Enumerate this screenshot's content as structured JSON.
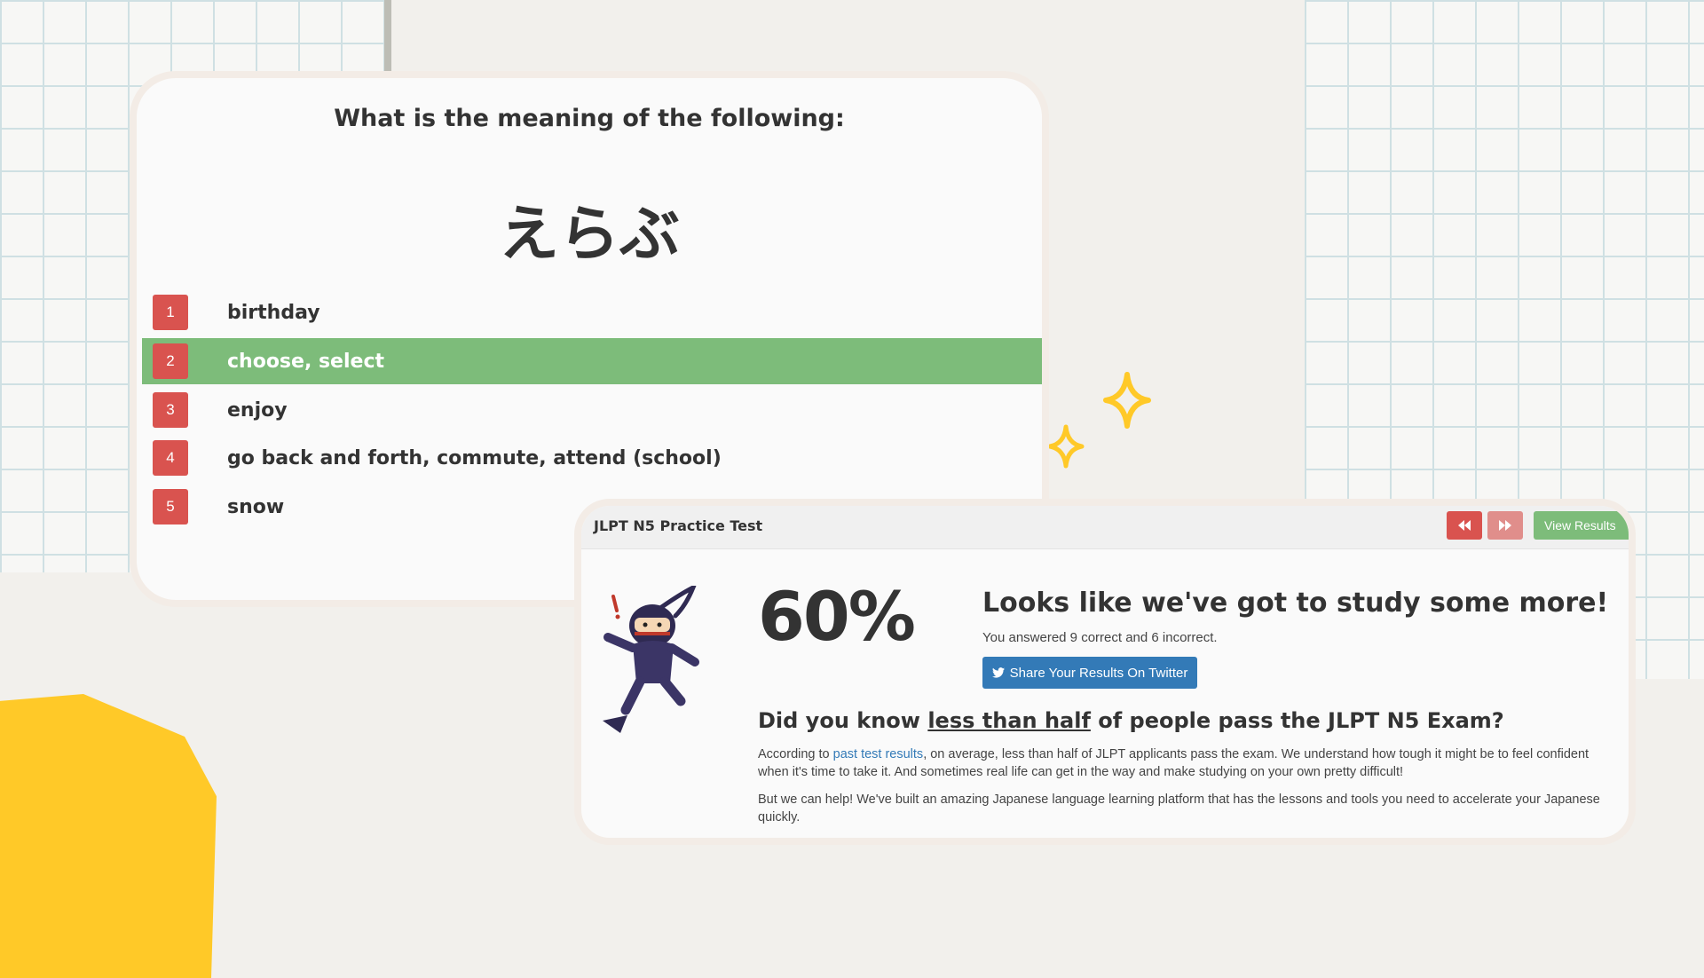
{
  "colors": {
    "option_badge": "#d9534f",
    "selected_option": "#7dbc7a",
    "twitter_button": "#337ab7",
    "accent_yellow": "#ffc928",
    "link": "#337ab7"
  },
  "quiz": {
    "question": "What is the meaning of the following:",
    "word": "えらぶ",
    "selected_index": 2,
    "options": [
      {
        "number": "1",
        "text": "birthday"
      },
      {
        "number": "2",
        "text": "choose, select"
      },
      {
        "number": "3",
        "text": "enjoy"
      },
      {
        "number": "4",
        "text": "go back and forth, commute, attend (school)"
      },
      {
        "number": "5",
        "text": "snow"
      }
    ]
  },
  "results": {
    "header_title": "JLPT N5 Practice Test",
    "prev_icon": "fast-backward-icon",
    "next_icon": "fast-forward-icon",
    "view_results_label": "View Results",
    "score": "60%",
    "headline": "Looks like we've got to study some more!",
    "summary": "You answered 9 correct and 6 incorrect.",
    "twitter_icon": "twitter-icon",
    "twitter_label": "Share Your Results On Twitter",
    "did_you_know_prefix": "Did you know ",
    "did_you_know_emphasis": "less than half",
    "did_you_know_suffix": " of people pass the JLPT N5 Exam?",
    "para1_prefix": "According to ",
    "para1_link": "past test results",
    "para1_suffix": ", on average, less than half of JLPT applicants pass the exam. We understand how tough it might be to feel confident when it's time to take it. And sometimes real life can get in the way and make studying on your own pretty difficult!",
    "para2": "But we can help! We've built an amazing Japanese language learning platform that has the lessons and tools you need to accelerate your Japanese quickly.",
    "mascot": "ninja-mascot"
  },
  "decorations": [
    "sparkle-icon",
    "sparkle-icon"
  ]
}
